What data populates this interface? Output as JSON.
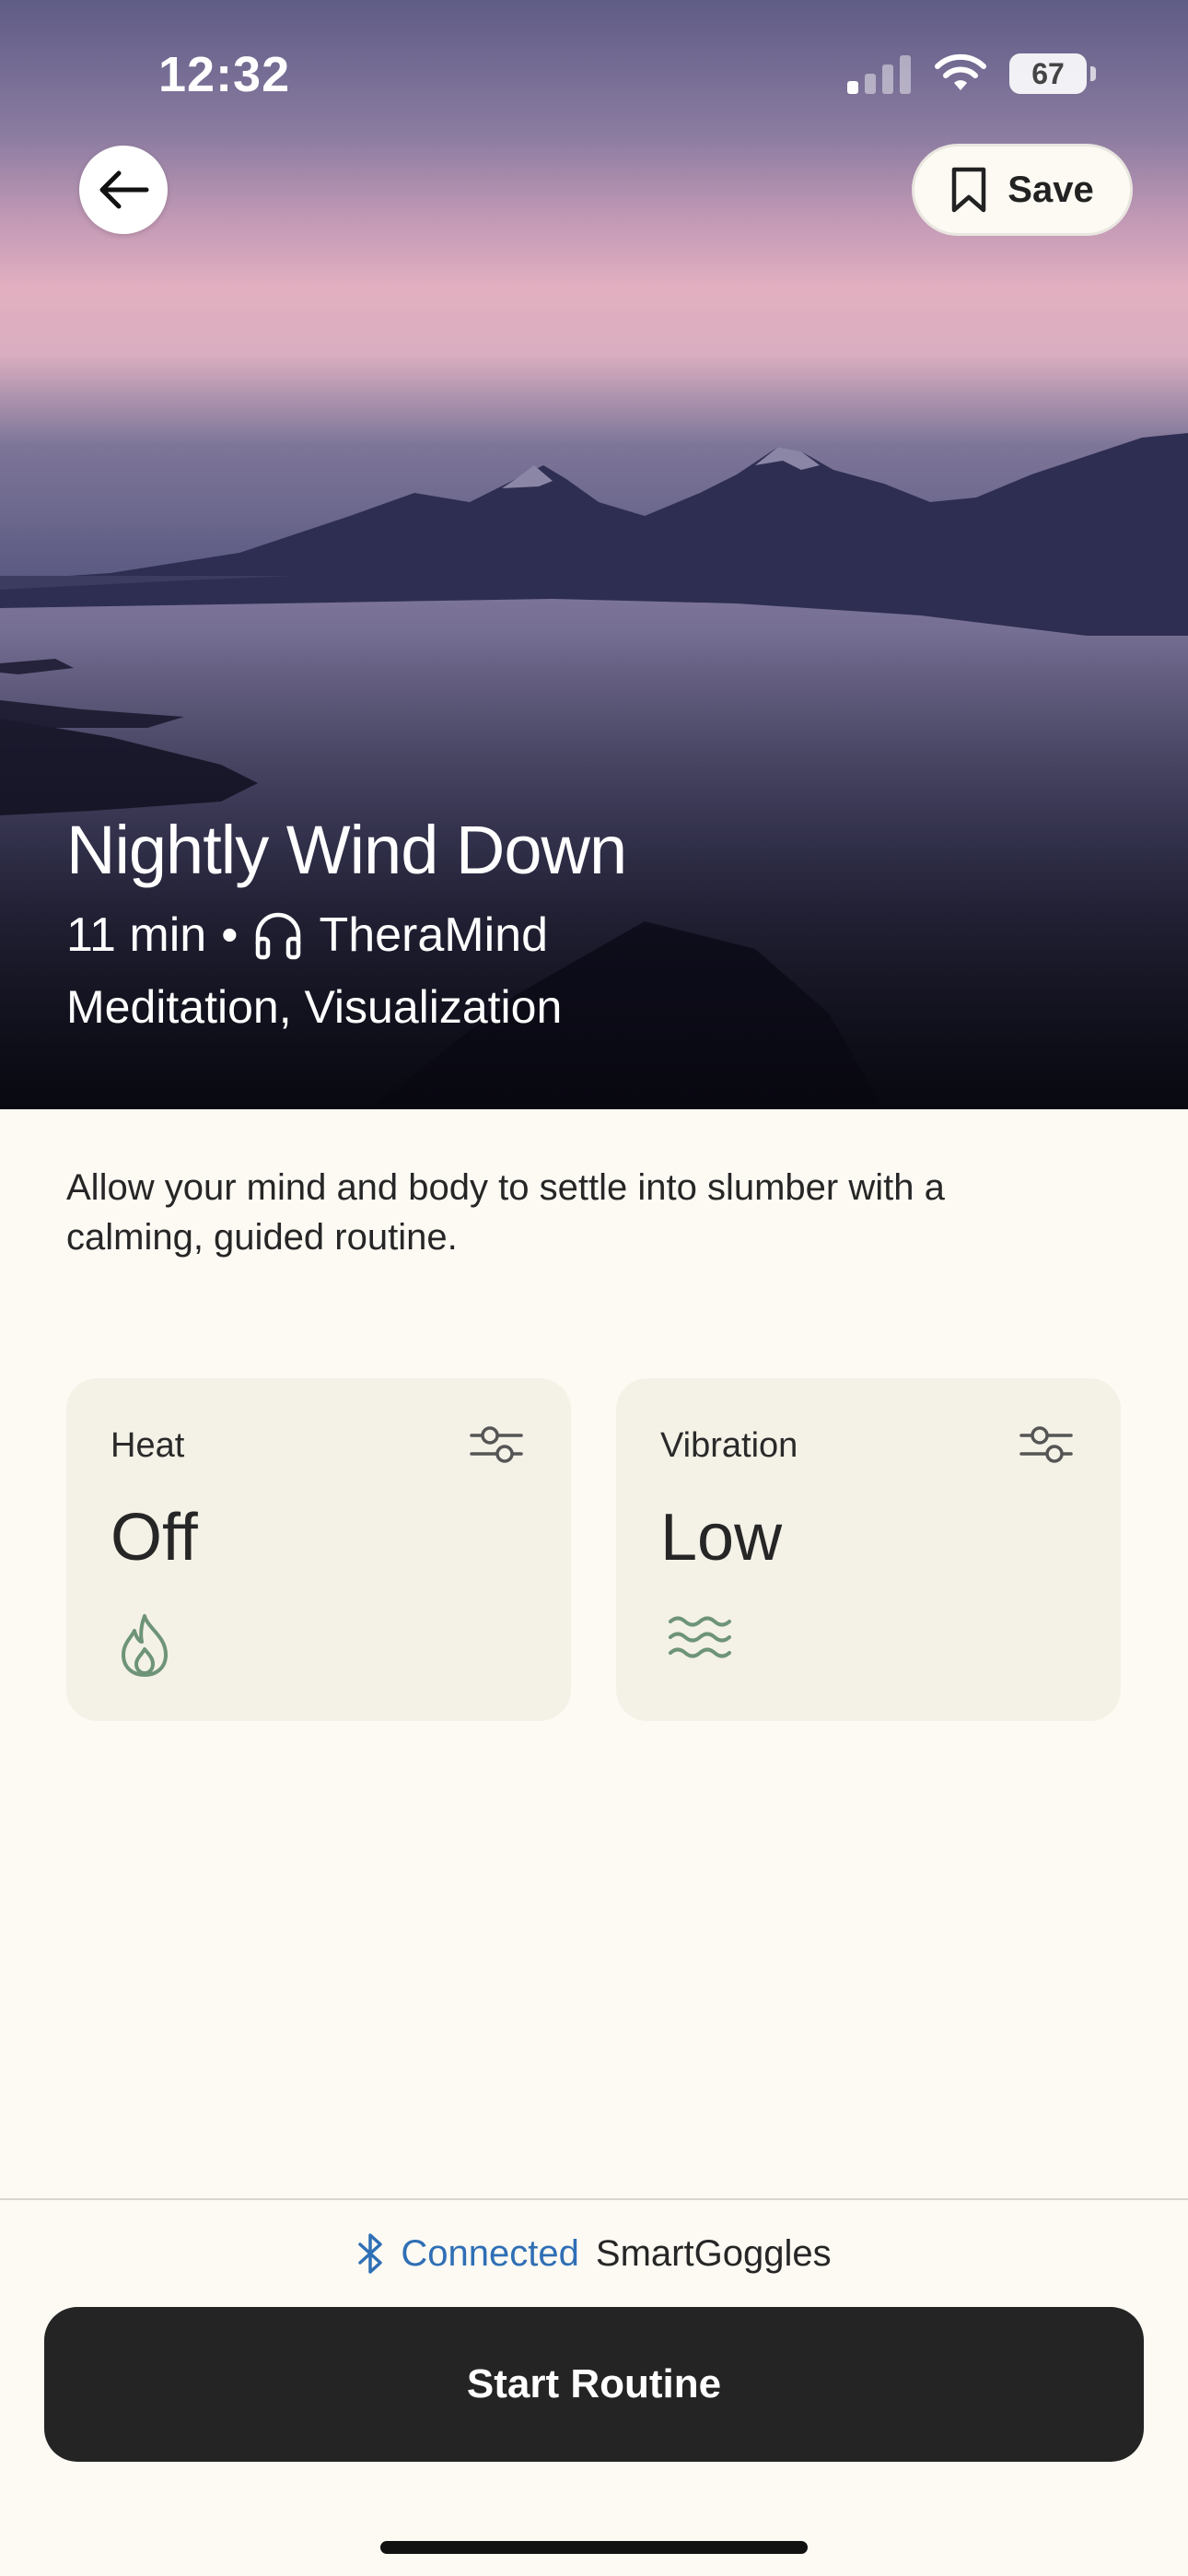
{
  "status_bar": {
    "time": "12:32",
    "battery": "67"
  },
  "header": {
    "save_label": "Save"
  },
  "hero": {
    "title": "Nightly Wind Down",
    "duration": "11 min",
    "separator": "•",
    "provider": "TheraMind",
    "tags": "Meditation, Visualization"
  },
  "description": "Allow your mind and body to settle into slumber with a calming, guided routine.",
  "settings": [
    {
      "label": "Heat",
      "value": "Off",
      "icon": "flame-icon"
    },
    {
      "label": "Vibration",
      "value": "Low",
      "icon": "waves-icon"
    }
  ],
  "connection": {
    "status": "Connected",
    "device": "SmartGoggles"
  },
  "footer": {
    "start_label": "Start Routine"
  },
  "colors": {
    "accent_blue": "#2F6FB5",
    "icon_green": "#6E9478",
    "button_dark": "#242424",
    "background": "#FDFAF4",
    "card": "#F4F1E7"
  }
}
